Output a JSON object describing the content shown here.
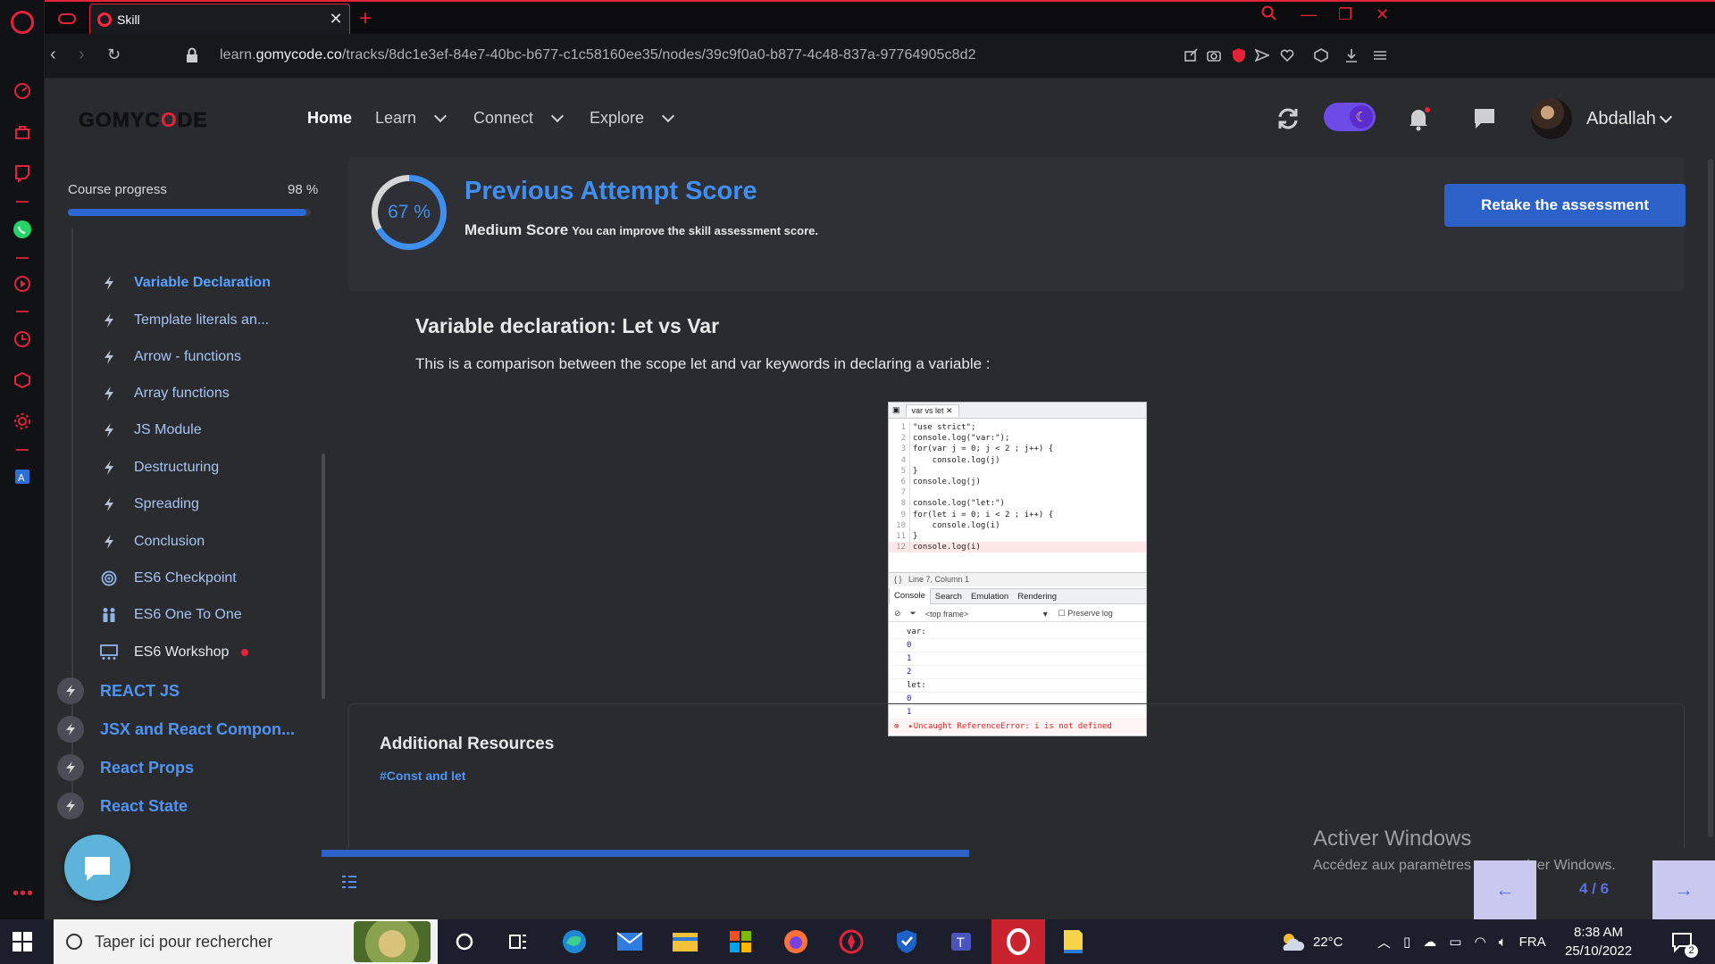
{
  "browser": {
    "tab_title": "Skill",
    "url_prefix": "learn.",
    "url_domain": "gomycode.co",
    "url_path": "/tracks/8dc1e3ef-84e7-40bc-b677-c1c58160ee35/nodes/39c9f0a0-b877-4c48-837a-97764905c8d2"
  },
  "nav": {
    "logo_part1": "GOMYC",
    "logo_part2": "O",
    "logo_part3": "DE",
    "home": "Home",
    "learn": "Learn",
    "connect": "Connect",
    "explore": "Explore",
    "username": "Abdallah"
  },
  "course": {
    "progress_label": "Course progress",
    "progress_value": "98 %",
    "progress_fraction": 0.98,
    "lessons": [
      {
        "label": "Variable Declaration",
        "icon": "bolt-icon"
      },
      {
        "label": "Template literals an...",
        "icon": "bolt-icon"
      },
      {
        "label": "Arrow - functions",
        "icon": "bolt-icon"
      },
      {
        "label": "Array functions",
        "icon": "bolt-icon"
      },
      {
        "label": "JS Module",
        "icon": "bolt-icon"
      },
      {
        "label": "Destructuring",
        "icon": "bolt-icon"
      },
      {
        "label": "Spreading",
        "icon": "bolt-icon"
      },
      {
        "label": "Conclusion",
        "icon": "bolt-icon"
      },
      {
        "label": "ES6 Checkpoint",
        "icon": "target-icon"
      },
      {
        "label": "ES6 One To One",
        "icon": "people-icon"
      },
      {
        "label": "ES6 Workshop",
        "icon": "workshop-icon"
      }
    ],
    "modules": [
      "REACT JS",
      "JSX and React Compon...",
      "React Props",
      "React State"
    ]
  },
  "score": {
    "percent": "67 %",
    "percent_value": 67,
    "title": "Previous Attempt Score",
    "level": "Medium Score",
    "hint": "You can improve the skill assessment score.",
    "retake_label": "Retake the assessment"
  },
  "content": {
    "title": "Variable declaration: Let vs Var",
    "description": "This is a comparison between the scope let and var keywords in declaring a variable :"
  },
  "codeshot": {
    "tab": "var vs let",
    "lines": [
      "\"use strict\";",
      "console.log(\"var:\");",
      "for(var j = 0; j < 2 ; j++) {",
      "    console.log(j)",
      "}",
      "console.log(j)",
      "",
      "console.log(\"let:\")",
      "for(let i = 0; i < 2 ; i++) {",
      "    console.log(i)",
      "}",
      "console.log(i)"
    ],
    "status": "Line 7, Column 1",
    "console_tabs": [
      "Console",
      "Search",
      "Emulation",
      "Rendering"
    ],
    "frame": "<top frame>",
    "preserve_log": "Preserve log",
    "output": [
      "var:",
      "0",
      "1",
      "2",
      "let:",
      "0",
      "1"
    ],
    "error": "Uncaught ReferenceError: i is not defined"
  },
  "resources": {
    "title": "Additional Resources",
    "link": "#Const and let"
  },
  "pager": {
    "text": "4 / 6",
    "progress_fraction": 0.465
  },
  "watermark": {
    "line1": "Activer Windows",
    "line2": "Accédez aux paramètres pour activer Windows."
  },
  "taskbar": {
    "search_placeholder": "Taper ici pour rechercher",
    "weather": "22°C",
    "language": "FRA",
    "time": "8:38 AM",
    "date": "25/10/2022",
    "notifications": "2"
  },
  "colors": {
    "accent": "#3f8ff0",
    "opera_red": "#e2233a",
    "button_blue": "#2c62c8"
  }
}
